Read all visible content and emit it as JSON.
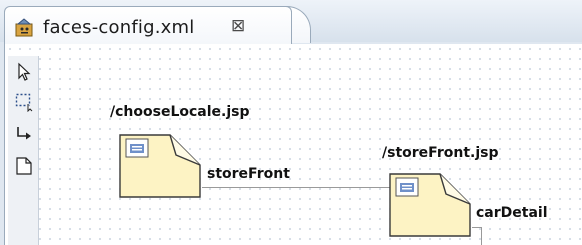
{
  "tab": {
    "title": "faces-config.xml",
    "close_icon_glyph": "⊠"
  },
  "palette": {
    "items": [
      {
        "icon": "select-arrow-icon"
      },
      {
        "icon": "marquee-icon"
      },
      {
        "icon": "connection-icon"
      },
      {
        "icon": "page-icon"
      }
    ]
  },
  "diagram": {
    "pages": [
      {
        "label": "/chooseLocale.jsp"
      },
      {
        "label": "/storeFront.jsp"
      }
    ],
    "navigation_cases": [
      {
        "label": "storeFront"
      },
      {
        "label": "carDetail"
      }
    ]
  },
  "colors": {
    "page_fill": "#fdf3c4",
    "page_stroke": "#3a3a3a",
    "tab_border": "#9aaabb",
    "grid_dot": "#c9d3e0"
  }
}
